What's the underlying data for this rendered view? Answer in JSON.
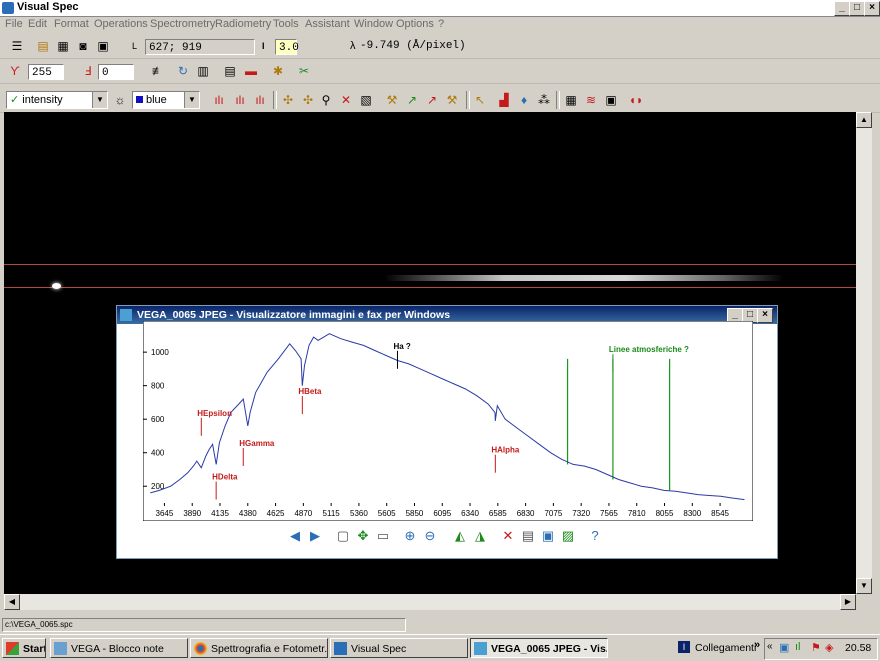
{
  "window": {
    "title": "Visual Spec",
    "min": "_",
    "max": "□",
    "close": "×"
  },
  "menu": [
    "File",
    "Edit",
    "Format",
    "Operations",
    "Spectrometry",
    "Radiometry",
    "Tools",
    "Assistant",
    "Window",
    "Options",
    "?"
  ],
  "toolbar1": {
    "l_label": "L",
    "coords": "627; 919",
    "i_label": "I",
    "i_value": "3.0",
    "dispersion": "-9.749 (Å/pixel)"
  },
  "toolbar2": {
    "value_a": "255",
    "value_b": "0"
  },
  "toolbar3": {
    "profile_select": "intensity",
    "color_select": "blue"
  },
  "status": {
    "path": "c:\\VEGA_0065.spc"
  },
  "viewer": {
    "title": "VEGA_0065 JPEG - Visualizzatore immagini e fax per Windows"
  },
  "chart_data": {
    "type": "line",
    "title": "",
    "xlabel": "",
    "ylabel": "",
    "xlim": [
      3500,
      8800
    ],
    "ylim": [
      100,
      1150
    ],
    "x_ticks": [
      "3645",
      "3890",
      "4135",
      "4380",
      "4625",
      "4870",
      "5115",
      "5360",
      "5605",
      "5850",
      "6095",
      "6340",
      "6585",
      "6830",
      "7075",
      "7320",
      "7565",
      "7810",
      "8055",
      "8300",
      "8545"
    ],
    "y_ticks": [
      "200",
      "400",
      "600",
      "800",
      "1000"
    ],
    "series": [
      {
        "color": "#2a3aa8",
        "x": [
          3520,
          3600,
          3700,
          3780,
          3850,
          3900,
          3930,
          3970,
          4010,
          4040,
          4070,
          4101,
          4130,
          4180,
          4230,
          4300,
          4340,
          4380,
          4400,
          4450,
          4550,
          4650,
          4750,
          4800,
          4850,
          4861,
          4880,
          4920,
          4960,
          5000,
          5100,
          5200,
          5300,
          5400,
          5500,
          5600,
          5700,
          5800,
          5900,
          6000,
          6100,
          6200,
          6300,
          6400,
          6500,
          6560,
          6563,
          6580,
          6650,
          6750,
          6850,
          6950,
          7050,
          7150,
          7250,
          7350,
          7450,
          7550,
          7650,
          7750,
          7850,
          7950,
          8050,
          8150,
          8250,
          8350,
          8450,
          8550,
          8650,
          8760
        ],
        "y": [
          160,
          175,
          200,
          240,
          280,
          320,
          350,
          310,
          380,
          420,
          450,
          330,
          460,
          560,
          640,
          690,
          720,
          560,
          640,
          760,
          880,
          960,
          1050,
          1010,
          960,
          800,
          920,
          1040,
          1090,
          1070,
          1110,
          1080,
          1060,
          1040,
          1010,
          980,
          950,
          930,
          900,
          870,
          840,
          810,
          780,
          740,
          690,
          640,
          590,
          680,
          600,
          550,
          500,
          450,
          400,
          360,
          330,
          320,
          300,
          270,
          240,
          220,
          200,
          190,
          175,
          170,
          160,
          150,
          145,
          140,
          130,
          120
        ]
      }
    ],
    "annotations": [
      {
        "text": "HEpsilon",
        "x": 3970,
        "y": 620,
        "color": "#c41a1a"
      },
      {
        "text": "HDelta",
        "x": 4101,
        "y": 240,
        "color": "#c41a1a"
      },
      {
        "text": "HGamma",
        "x": 4340,
        "y": 440,
        "color": "#c41a1a"
      },
      {
        "text": "HBeta",
        "x": 4861,
        "y": 750,
        "color": "#c41a1a"
      },
      {
        "text": "Ha ?",
        "x": 5700,
        "y": 1020,
        "color": "#000000"
      },
      {
        "text": "HAlpha",
        "x": 6563,
        "y": 400,
        "color": "#c41a1a"
      },
      {
        "text": "Linee atmosferiche ?",
        "x": 7600,
        "y": 1000,
        "color": "#1a8a1a"
      }
    ],
    "vlines": [
      {
        "x": 7200,
        "y0": 330,
        "y1": 960,
        "color": "#1a9a1a"
      },
      {
        "x": 7600,
        "y0": 240,
        "y1": 960,
        "color": "#1a9a1a"
      },
      {
        "x": 8100,
        "y0": 175,
        "y1": 960,
        "color": "#1a9a1a"
      }
    ],
    "grid": false
  },
  "taskbar": {
    "start": "Start",
    "tasks": [
      "VEGA - Blocco note",
      "Spettrografia e Fotometr...",
      "Visual Spec",
      "VEGA_0065 JPEG - Vis..."
    ],
    "links": "Collegamenti",
    "clock": "20.58"
  }
}
